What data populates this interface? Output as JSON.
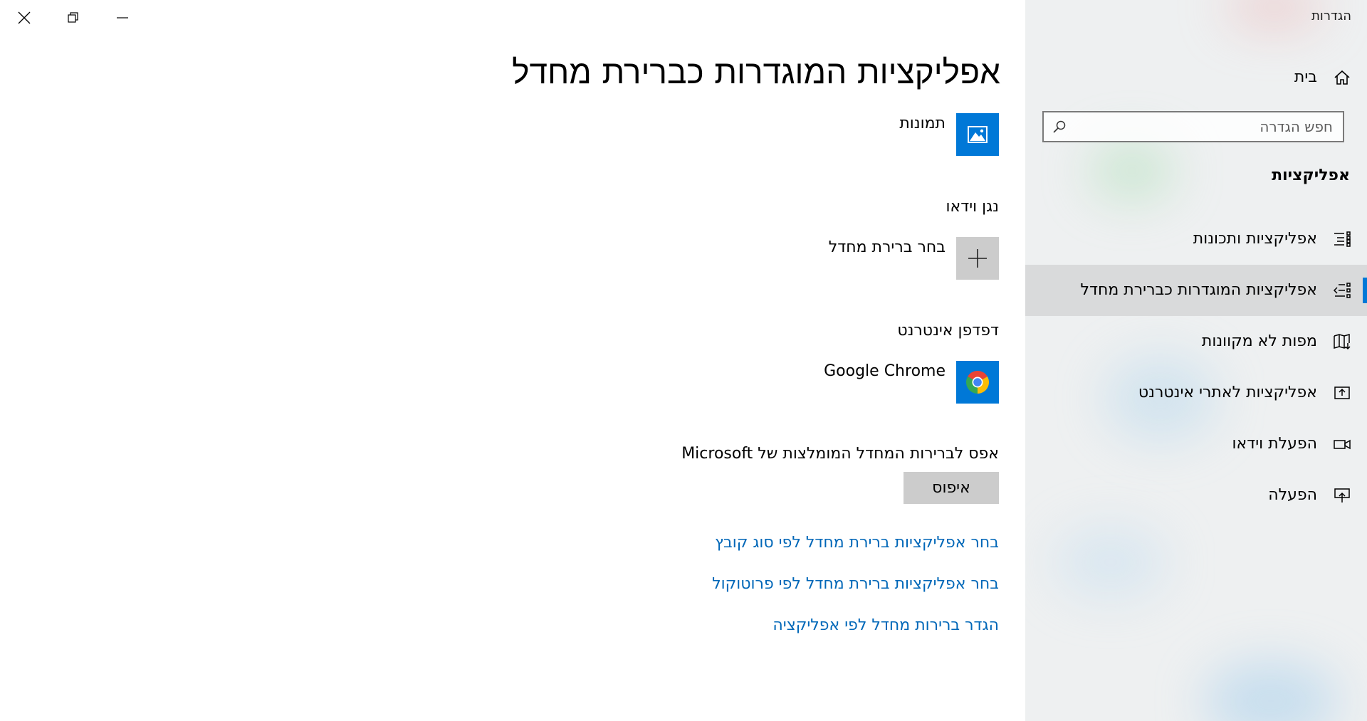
{
  "window": {
    "app_title": "הגדרות",
    "controls": {
      "minimize": "minimize-icon",
      "restore": "restore-icon",
      "close": "close-icon"
    }
  },
  "sidebar": {
    "home_label": "בית",
    "search_placeholder": "חפש הגדרה",
    "section_title": "אפליקציות",
    "items": [
      {
        "label": "אפליקציות ותכונות",
        "icon": "apps-features-icon",
        "selected": false
      },
      {
        "label": "אפליקציות המוגדרות כברירת מחדל",
        "icon": "default-apps-icon",
        "selected": true
      },
      {
        "label": "מפות לא מקוונות",
        "icon": "offline-maps-icon",
        "selected": false
      },
      {
        "label": "אפליקציות לאתרי אינטרנט",
        "icon": "apps-for-websites-icon",
        "selected": false
      },
      {
        "label": "הפעלת וידאו",
        "icon": "video-playback-icon",
        "selected": false
      },
      {
        "label": "הפעלה",
        "icon": "startup-icon",
        "selected": false
      }
    ]
  },
  "main": {
    "title": "אפליקציות המוגדרות כברירת מחדל",
    "photos": {
      "app_name": "תמונות"
    },
    "video": {
      "category": "נגן וידאו",
      "app_name": "בחר ברירת מחדל"
    },
    "browser": {
      "category": "דפדפן אינטרנט",
      "app_name": "Google Chrome"
    },
    "reset": {
      "label": "אפס לברירות המחדל המומלצות של Microsoft",
      "button": "איפוס"
    },
    "links": [
      "בחר אפליקציות ברירת מחדל לפי סוג קובץ",
      "בחר אפליקציות ברירת מחדל לפי פרוטוקול",
      "הגדר ברירות מחדל לפי אפליקציה"
    ]
  },
  "colors": {
    "accent": "#0078d7",
    "link": "#0067b8",
    "tile": "#0078d7",
    "sidebar_bg": "#eef0f1",
    "selected_bg": "#d9dadb",
    "button_bg": "#cccccc"
  }
}
